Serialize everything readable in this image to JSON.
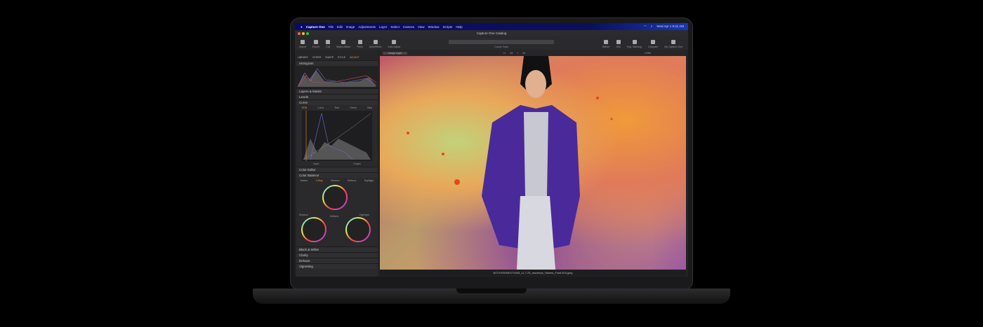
{
  "menubar": {
    "app": "Capture One",
    "items": [
      "File",
      "Edit",
      "Image",
      "Adjustments",
      "Layer",
      "Select",
      "Camera",
      "View",
      "Window",
      "Scripts",
      "Help"
    ],
    "clock": "Wed Apr 1  9:41 AM"
  },
  "window": {
    "title": "Capture One Catalog"
  },
  "toolbar": {
    "left": [
      "Import",
      "Export",
      "Cull",
      "Styles Album",
      "Redo",
      "Undo/Redo",
      "Auto Adjust"
    ],
    "center": "Cursor Tools",
    "right": [
      "Before",
      "Grid",
      "Exp. Warning",
      "Compare",
      "My Capture One"
    ]
  },
  "left_tabs": [
    "LIBRARY",
    "OTHER",
    "SHAPE",
    "STYLE",
    "ADJUST"
  ],
  "active_left_tab": "ADJUST",
  "viewer": {
    "layer": "Image Layer",
    "zoom": "176%",
    "counts": [
      "24",
      "22",
      "3",
      "21"
    ],
    "filename": "NOTHOSHIEST1605_11.7.25_monkeys_Sisters_Final.004.jpeg"
  },
  "panels": {
    "histogram": "Histogram",
    "layers_masks": "Layers & Masks",
    "levels": "Levels",
    "curve": "Curve",
    "curve_tabs": [
      "RGB",
      "Luma",
      "Red",
      "Green",
      "Blue"
    ],
    "curve_io": [
      "Input",
      "Output"
    ],
    "color_editor": "Color Editor",
    "color_balance": "Color Balance",
    "cb_tabs": [
      "Master",
      "3-Way",
      "Shadow",
      "Midtone",
      "Highlight"
    ],
    "cb_labels": [
      "Shadow",
      "Midtone",
      "Highlight"
    ],
    "bw": "Black & White",
    "clarity": "Clarity",
    "dehaze": "Dehaze",
    "vignetting": "Vignetting"
  },
  "colors": {
    "accent": "#e0923a",
    "menubar": "#0a0a6a",
    "coat": "#4a2a9a"
  }
}
